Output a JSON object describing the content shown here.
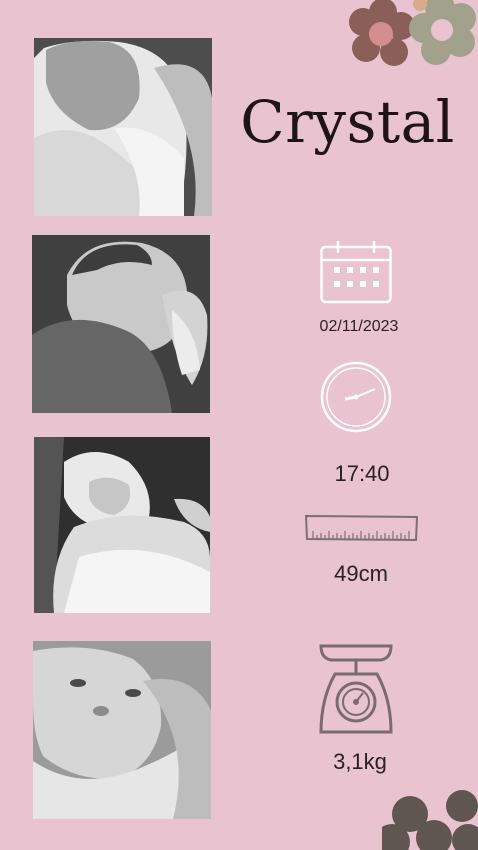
{
  "name": "Crystal",
  "details": {
    "date": "02/11/2023",
    "time": "17:40",
    "length": "49cm",
    "weight": "3,1kg"
  },
  "icons": {
    "date": "calendar-icon",
    "time": "clock-icon",
    "length": "ruler-icon",
    "weight": "scale-icon"
  },
  "colors": {
    "background": "#eac3d1",
    "icon_white": "#ffffff",
    "scale": "#7a6b72",
    "ruler": "#7d6e74",
    "flower_brown": "#8a5f57",
    "flower_pink": "#d38e8d",
    "flower_green": "#a2a28c",
    "flower_dark": "#5f5651",
    "text": "#1d1417"
  }
}
